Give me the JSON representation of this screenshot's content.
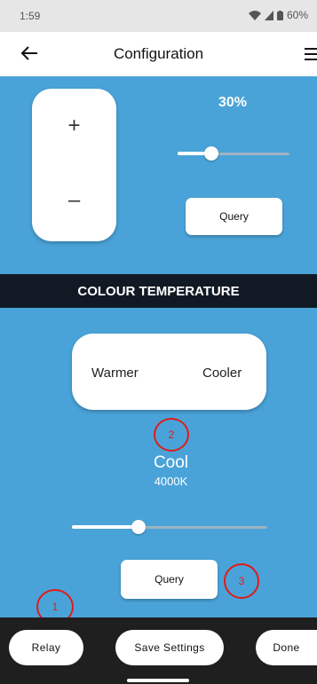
{
  "status": {
    "time": "1:59",
    "battery": "60%"
  },
  "appbar": {
    "title": "Configuration"
  },
  "brightness": {
    "plus": "+",
    "minus": "–",
    "percent_label": "30%",
    "level": 0.3,
    "query_label": "Query"
  },
  "colour_temperature": {
    "header": "COLOUR TEMPERATURE",
    "warmer_label": "Warmer",
    "cooler_label": "Cooler",
    "mode": "Cool",
    "kelvin": "4000K",
    "level": 0.34,
    "query_label": "Query"
  },
  "annotations": [
    "1",
    "2",
    "3"
  ],
  "bottom": {
    "relay": "Relay",
    "save": "Save Settings",
    "done": "Done"
  },
  "colors": {
    "accent": "#4aa3d8",
    "header_bg": "#111a24",
    "marker": "#e01b1b",
    "bottom_bg": "#1f1f1f"
  }
}
